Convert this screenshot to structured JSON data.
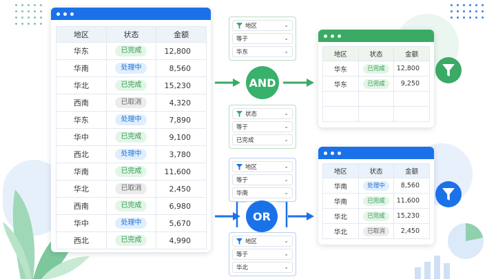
{
  "source_table": {
    "headers": [
      "地区",
      "状态",
      "金额"
    ],
    "rows": [
      {
        "region": "华东",
        "status": "已完成",
        "kind": "done",
        "amount": "12,800"
      },
      {
        "region": "华南",
        "status": "处理中",
        "kind": "prog",
        "amount": "8,560"
      },
      {
        "region": "华北",
        "status": "已完成",
        "kind": "done",
        "amount": "15,230"
      },
      {
        "region": "西南",
        "status": "已取消",
        "kind": "cancel",
        "amount": "4,320"
      },
      {
        "region": "华东",
        "status": "处理中",
        "kind": "prog",
        "amount": "7,890"
      },
      {
        "region": "华中",
        "status": "已完成",
        "kind": "done",
        "amount": "9,100"
      },
      {
        "region": "西北",
        "status": "处理中",
        "kind": "prog",
        "amount": "3,780"
      },
      {
        "region": "华南",
        "status": "已完成",
        "kind": "done",
        "amount": "11,600"
      },
      {
        "region": "华北",
        "status": "已取消",
        "kind": "cancel",
        "amount": "2,450"
      },
      {
        "region": "西南",
        "status": "已完成",
        "kind": "done",
        "amount": "6,980"
      },
      {
        "region": "华中",
        "status": "处理中",
        "kind": "prog",
        "amount": "5,670"
      },
      {
        "region": "西北",
        "status": "已完成",
        "kind": "done",
        "amount": "4,990"
      }
    ]
  },
  "and_filters": {
    "first": {
      "field": "地区",
      "operator": "等于",
      "value": "华东"
    },
    "second": {
      "field": "状态",
      "operator": "等于",
      "value": "已完成"
    },
    "label": "AND"
  },
  "or_filters": {
    "first": {
      "field": "地区",
      "operator": "等于",
      "value": "华南"
    },
    "second": {
      "field": "地区",
      "operator": "等于",
      "value": "华北"
    },
    "label": "OR"
  },
  "and_result": {
    "headers": [
      "地区",
      "状态",
      "金额"
    ],
    "rows": [
      {
        "region": "华东",
        "status": "已完成",
        "kind": "done",
        "amount": "12,800"
      },
      {
        "region": "华东",
        "status": "已完成",
        "kind": "done",
        "amount": "9,250"
      }
    ],
    "empty_rows": 2
  },
  "or_result": {
    "headers": [
      "地区",
      "状态",
      "金额"
    ],
    "rows": [
      {
        "region": "华南",
        "status": "处理中",
        "kind": "prog",
        "amount": "8,560"
      },
      {
        "region": "华南",
        "status": "已完成",
        "kind": "done",
        "amount": "11,600"
      },
      {
        "region": "华北",
        "status": "已完成",
        "kind": "done",
        "amount": "15,230"
      },
      {
        "region": "华北",
        "status": "已取消",
        "kind": "cancel",
        "amount": "2,450"
      }
    ],
    "empty_rows": 0
  },
  "colors": {
    "blue": "#1b72e8",
    "green": "#3aaa64",
    "and_circle": "#38b16a",
    "or_circle": "#1b72e8"
  },
  "icons": [
    "funnel-icon",
    "chevron-down-icon",
    "arrow-right-icon",
    "leaf-decoration",
    "pie-decoration",
    "bar-decoration"
  ]
}
